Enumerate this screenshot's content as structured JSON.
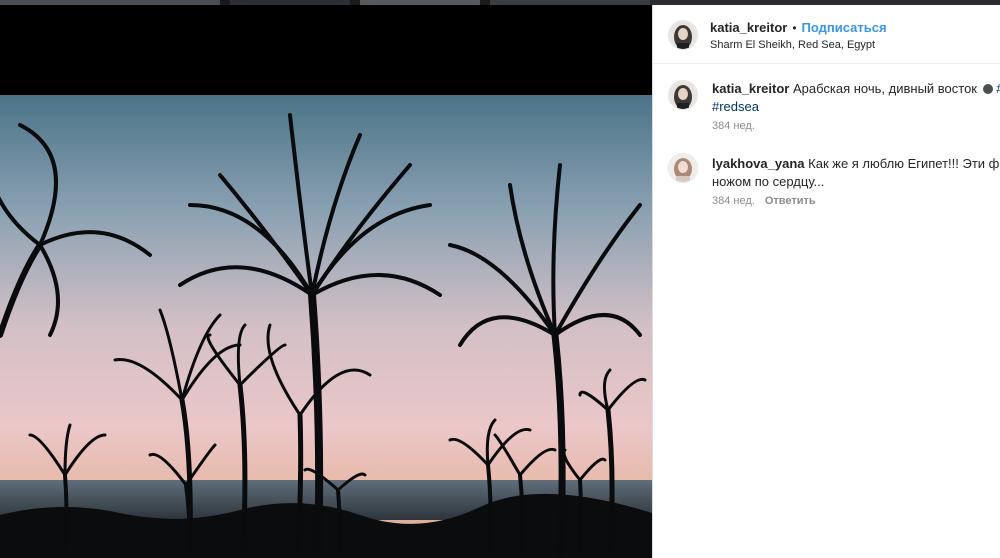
{
  "post": {
    "author": "katia_kreitor",
    "separator": "•",
    "follow_label": "Подписаться",
    "location": "Sharm El Sheikh, Red Sea, Egypt"
  },
  "comments": [
    {
      "user": "katia_kreitor",
      "text_line1": "Арабская ночь, дивный восток",
      "emoji": "new-moon-emoji",
      "tag_cut": "#",
      "tag_line2": "#redsea",
      "time": "384 нед."
    },
    {
      "user": "lyakhova_yana",
      "text_line1": "Как же я люблю Египет!!! Эти фот",
      "text_line2": "ножом по сердцу...",
      "time": "384 нед.",
      "reply_label": "Ответить"
    }
  ],
  "icons": {
    "avatar_1": "avatar-icon",
    "avatar_2": "avatar-icon",
    "emoji": "new-moon-emoji"
  },
  "colors": {
    "link_blue": "#3897f0",
    "hashtag": "#003569",
    "meta_gray": "#8e8e8e",
    "text": "#262626"
  }
}
